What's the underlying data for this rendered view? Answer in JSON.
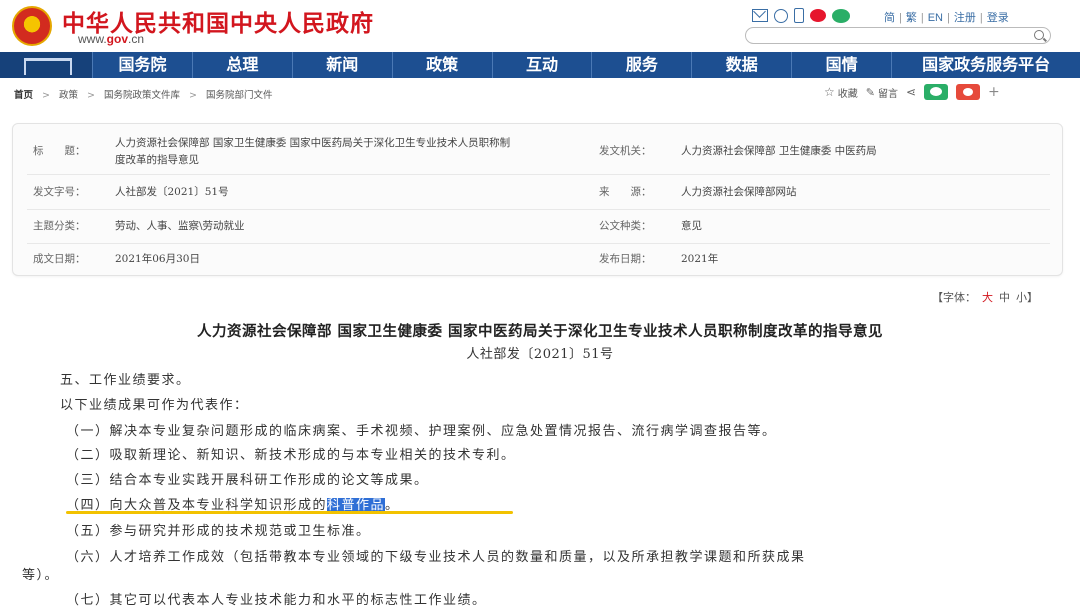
{
  "header": {
    "site_title": "中华人民共和国中央人民政府",
    "domain_prefix": "www.",
    "domain_brand": "gov",
    "domain_suffix": ".cn",
    "links": [
      "简",
      "繁",
      "EN",
      "注册",
      "登录"
    ],
    "brand_color": "#d2161e"
  },
  "nav": {
    "items": [
      "国务院",
      "总理",
      "新闻",
      "政策",
      "互动",
      "服务",
      "数据",
      "国情",
      "国家政务服务平台"
    ],
    "bg_color": "#1d4f91"
  },
  "breadcrumb": [
    "首页",
    "政策",
    "国务院政策文件库",
    "国务院部门文件"
  ],
  "tools": {
    "favorite": "收藏",
    "comment": "留言"
  },
  "info": {
    "title_label": "标　　题：",
    "title_value": "人力资源社会保障部 国家卫生健康委 国家中医药局关于深化卫生专业技术人员职称制度改革的指导意见",
    "issuer_label": "发文机关：",
    "issuer_value": "人力资源社会保障部 卫生健康委 中医药局",
    "docno_label": "发文字号：",
    "docno_value": "人社部发〔2021〕51号",
    "source_label": "来　　源：",
    "source_value": "人力资源社会保障部网站",
    "topic_label": "主题分类：",
    "topic_value": "劳动、人事、监察\\劳动就业",
    "type_label": "公文种类：",
    "type_value": "意见",
    "date_label": "成文日期：",
    "date_value": "2021年06月30日",
    "pub_label": "发布日期：",
    "pub_value": "2021年"
  },
  "fontsize": {
    "prefix": "【字体：",
    "big": "大",
    "mid": "中",
    "small": "小】"
  },
  "article": {
    "title": "人力资源社会保障部 国家卫生健康委 国家中医药局关于深化卫生专业技术人员职称制度改革的指导意见",
    "subtitle": "人社部发〔2021〕51号",
    "p1": "五、工作业绩要求。",
    "p2": "以下业绩成果可作为代表作：",
    "p3": "（一）解决本专业复杂问题形成的临床病案、手术视频、护理案例、应急处置情况报告、流行病学调查报告等。",
    "p4": "（二）吸取新理论、新知识、新技术形成的与本专业相关的技术专利。",
    "p5": "（三）结合本专业实践开展科研工作形成的论文等成果。",
    "p6_before": "（四）向大众普及本专业科学知识形成的",
    "p6_highlight": "科普作品",
    "p6_after": "。",
    "p7": "（五）参与研究并形成的技术规范或卫生标准。",
    "p8": "（六）人才培养工作成效（包括带教本专业领域的下级专业技术人员的数量和质量，以及所承担教学课题和所获成果",
    "p8_cont": "等）。",
    "p9": "（七）其它可以代表本人专业技术能力和水平的标志性工作业绩。"
  }
}
